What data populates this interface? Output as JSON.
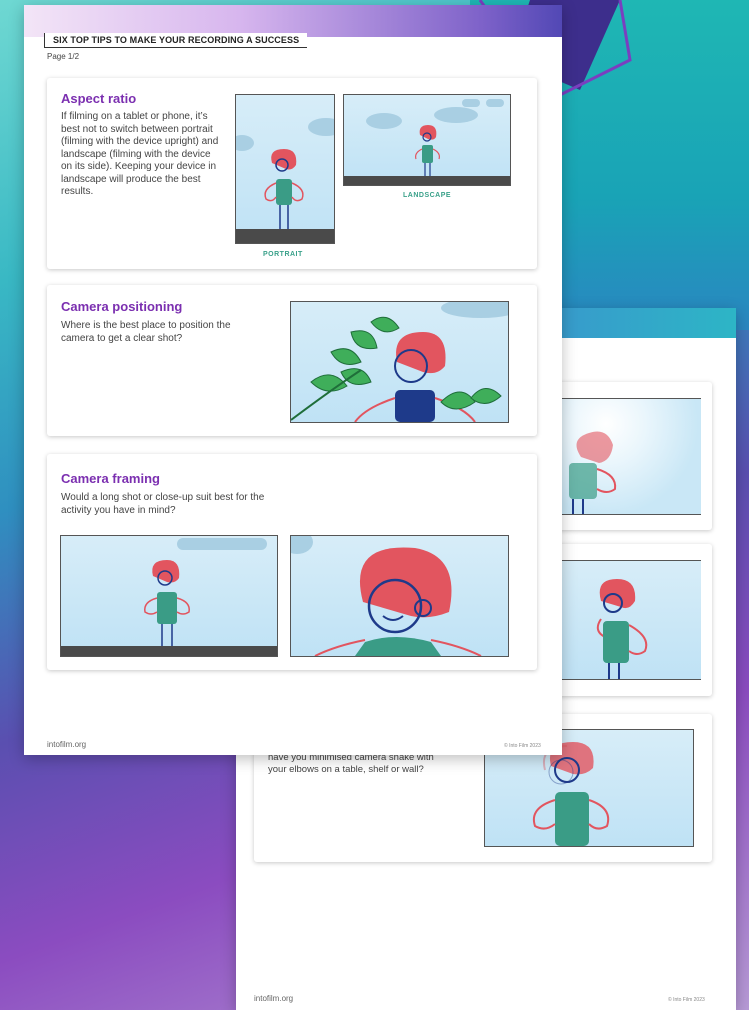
{
  "back_page": {
    "text_lines": [
      "have you minimised camera shake with",
      "your elbows on a table, shelf or wall?"
    ],
    "footer_left": "intofilm.org",
    "footer_right": "© Into Film 2023"
  },
  "front_page": {
    "title": "SIX TOP TIPS TO MAKE YOUR RECORDING A SUCCESS",
    "page_number": "Page 1/2",
    "sections": [
      {
        "heading": "Aspect ratio",
        "body": "If filming on a tablet or phone, it’s best not to switch between portrait (filming with the device upright) and landscape (filming with the device on its side). Keeping your device in landscape will produce the best results.",
        "captions": [
          "PORTRAIT",
          "LANDSCAPE"
        ]
      },
      {
        "heading": "Camera positioning",
        "body": "Where is the best place to position the camera to get a clear shot?"
      },
      {
        "heading": "Camera framing",
        "body": "Would a long shot or close-up suit best for the activity you have in mind?"
      }
    ],
    "footer_left": "intofilm.org",
    "footer_right": "© Into Film 2023"
  },
  "colors": {
    "heading": "#7b2fb0",
    "caption": "#3aa18a",
    "character_hair": "#e2555f",
    "character_body": "#3a9c86",
    "character_outline": "#1e3a8a"
  }
}
